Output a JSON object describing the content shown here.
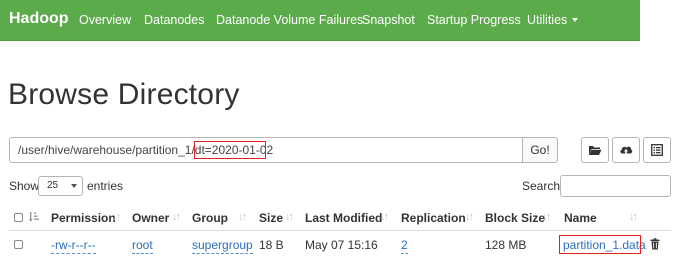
{
  "navbar": {
    "brand": "Hadoop",
    "items": [
      "Overview",
      "Datanodes",
      "Datanode Volume Failures",
      "Snapshot",
      "Startup Progress",
      "Utilities"
    ]
  },
  "page_title": "Browse Directory",
  "path_bar": {
    "path_prefix": "/user/hive/warehouse/partition_1/",
    "path_highlighted": "dt=2020-01-02",
    "go_label": "Go!",
    "icons": [
      "folder-open-icon",
      "cloud-upload-icon",
      "list-alt-icon"
    ]
  },
  "table_controls": {
    "show_label": "Show",
    "entries_value": "25",
    "entries_label": "entries",
    "search_label": "Search:"
  },
  "table": {
    "columns": [
      "Permission",
      "Owner",
      "Group",
      "Size",
      "Last Modified",
      "Replication",
      "Block Size",
      "Name"
    ],
    "rows": [
      {
        "permission": "-rw-r--r--",
        "owner": "root",
        "group": "supergroup",
        "size": "18 B",
        "last_modified": "May 07 15:16",
        "replication": "2",
        "block_size": "128 MB",
        "name": "partition_1.data"
      }
    ]
  },
  "colors": {
    "navbar_bg": "#5cab4b",
    "highlight_border": "#e02020",
    "link": "#2a6ebb"
  }
}
